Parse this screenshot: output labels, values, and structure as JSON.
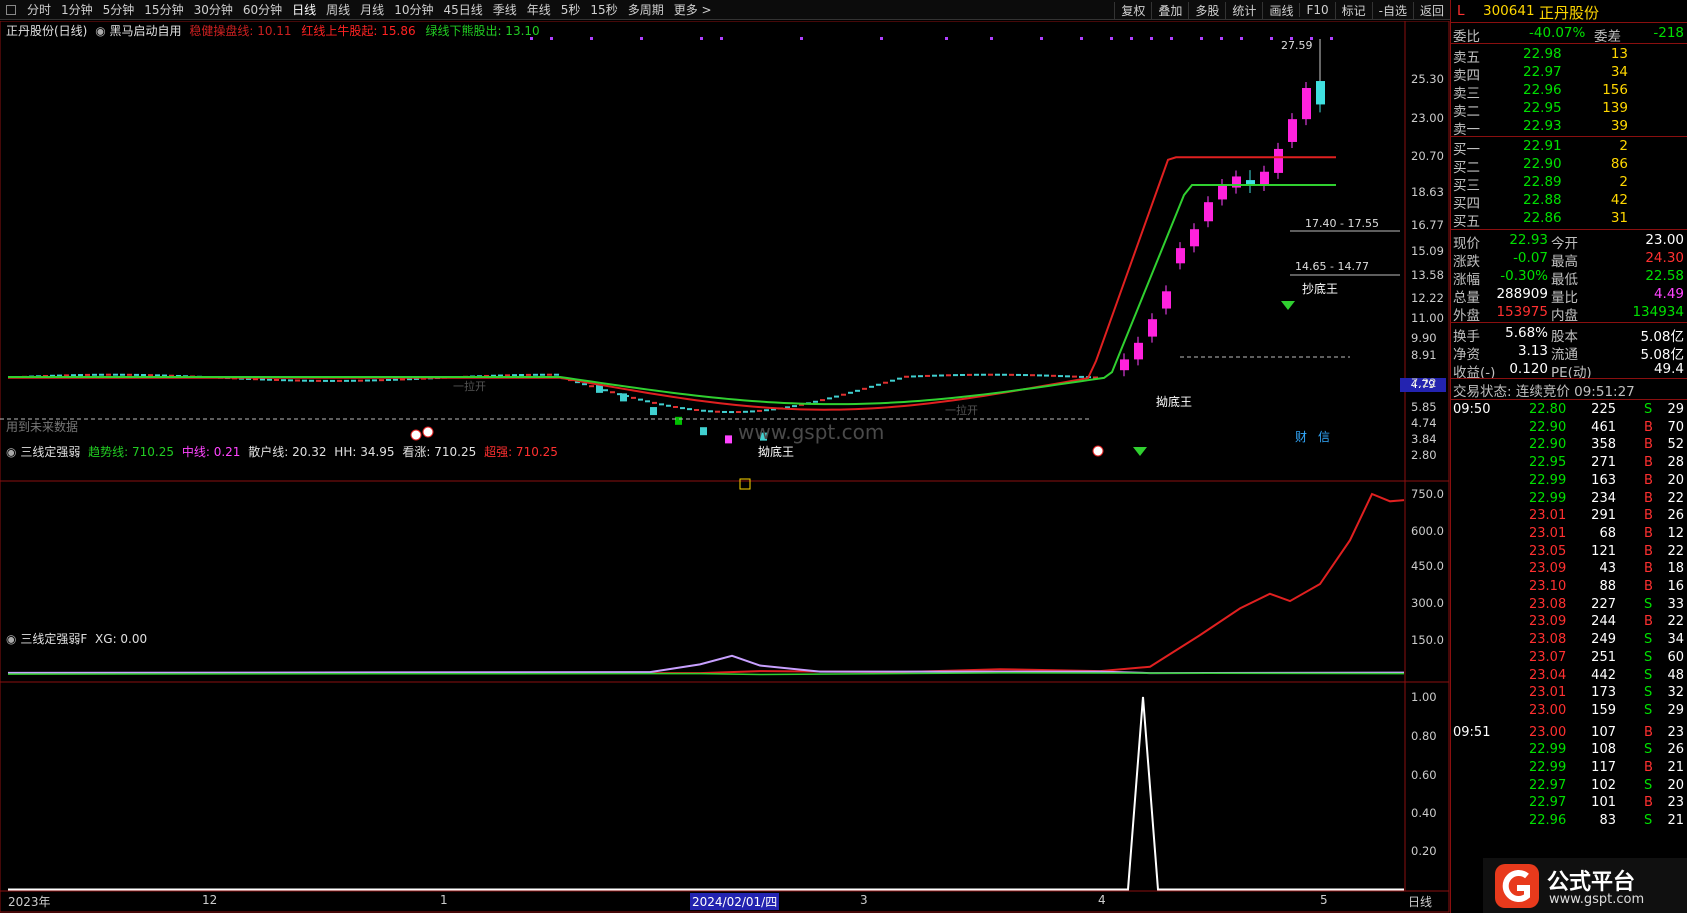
{
  "toolbar": {
    "left": [
      "分时",
      "1分钟",
      "5分钟",
      "15分钟",
      "30分钟",
      "60分钟",
      "日线",
      "周线",
      "月线",
      "10分钟",
      "45日线",
      "季线",
      "年线",
      "5秒",
      "15秒",
      "多周期",
      "更多 >"
    ],
    "selected": "日线",
    "right": [
      "复权",
      "叠加",
      "多股",
      "统计",
      "画线",
      "F10",
      "标记",
      "-自选",
      "返回"
    ]
  },
  "main_panel": {
    "stock_title": "正丹股份(日线)",
    "indicator": "黑马启动自用",
    "lbl1": "稳健操盘线: 10.11",
    "lbl2": "红线上牛股起: 15.86",
    "lbl3": "绿线下熊股出: 13.10",
    "future_note": "用到未来数据",
    "watermark": "www.gspt.com",
    "price_axis": [
      "25.30",
      "23.00",
      "20.70",
      "18.63",
      "16.77",
      "15.09",
      "13.58",
      "12.22",
      "11.00",
      "9.90",
      "8.91",
      "7.22",
      "5.85",
      "4.74",
      "3.84",
      "2.80"
    ],
    "current_price_tag": "4.79",
    "hi_label": "27.59",
    "band1": "17.40 - 17.55",
    "band2": "14.65 - 14.77",
    "ann": [
      "拗底王",
      "拗底王",
      "抄底王",
      "一拉开",
      "一拉开",
      "拗底王"
    ],
    "caibadge": "财",
    "xinbadge": "信"
  },
  "panel2": {
    "title": "三线定强弱",
    "trend": "趋势线: 710.25",
    "mid": "中线: 0.21",
    "retail": "散户线: 20.32",
    "hh": "HH: 34.95",
    "up": "看涨: 710.25",
    "sup": "超强: 710.25",
    "axis": [
      "750.0",
      "600.0",
      "450.0",
      "300.0",
      "150.0"
    ]
  },
  "panel3": {
    "title": "三线定强弱F",
    "xg": "XG: 0.00",
    "axis": [
      "1.00",
      "0.80",
      "0.60",
      "0.40",
      "0.20"
    ]
  },
  "time_axis": {
    "labels": [
      "2023年",
      "12",
      "1",
      "2024/02/01/四",
      "3",
      "4",
      "5"
    ],
    "period": "日线"
  },
  "quote": {
    "flag": "L",
    "code": "300641",
    "name": "正丹股份",
    "weibi": {
      "label": "委比",
      "value": "-40.07%",
      "label2": "委差",
      "value2": "-218"
    },
    "asks": [
      {
        "name": "卖五",
        "price": "22.98",
        "vol": "13"
      },
      {
        "name": "卖四",
        "price": "22.97",
        "vol": "34"
      },
      {
        "name": "卖三",
        "price": "22.96",
        "vol": "156"
      },
      {
        "name": "卖二",
        "price": "22.95",
        "vol": "139"
      },
      {
        "name": "卖一",
        "price": "22.93",
        "vol": "39"
      }
    ],
    "bids": [
      {
        "name": "买一",
        "price": "22.91",
        "vol": "2"
      },
      {
        "name": "买二",
        "price": "22.90",
        "vol": "86"
      },
      {
        "name": "买三",
        "price": "22.89",
        "vol": "2"
      },
      {
        "name": "买四",
        "price": "22.88",
        "vol": "42"
      },
      {
        "name": "买五",
        "price": "22.86",
        "vol": "31"
      }
    ],
    "stats": [
      {
        "l1": "现价",
        "v1": "22.93",
        "c1": "#00e000",
        "l2": "今开",
        "v2": "23.00",
        "c2": "#ffffff"
      },
      {
        "l1": "涨跌",
        "v1": "-0.07",
        "c1": "#00e000",
        "l2": "最高",
        "v2": "24.30",
        "c2": "#ff3030"
      },
      {
        "l1": "涨幅",
        "v1": "-0.30%",
        "c1": "#00e000",
        "l2": "最低",
        "v2": "22.58",
        "c2": "#00e000"
      },
      {
        "l1": "总量",
        "v1": "288909",
        "c1": "#ffffff",
        "l2": "量比",
        "v2": "4.49",
        "c2": "#ff44ff"
      },
      {
        "l1": "外盘",
        "v1": "153975",
        "c1": "#ff3030",
        "l2": "内盘",
        "v2": "134934",
        "c2": "#00e000"
      }
    ],
    "stats2": [
      {
        "l1": "换手",
        "v1": "5.68%",
        "l2": "股本",
        "v2": "5.08亿"
      },
      {
        "l1": "净资",
        "v1": "3.13",
        "l2": "流通",
        "v2": "5.08亿"
      },
      {
        "l1": "收益(-)",
        "v1": "0.120",
        "l2": "PE(动)",
        "v2": "49.4"
      }
    ],
    "trade_status": "交易状态: 连续竞价 09:51:27",
    "ticks": [
      {
        "t": "09:50",
        "p": "22.80",
        "v": "225",
        "bs": "S",
        "n": "29"
      },
      {
        "t": "",
        "p": "22.90",
        "v": "461",
        "bs": "B",
        "n": "70"
      },
      {
        "t": "",
        "p": "22.90",
        "v": "358",
        "bs": "B",
        "n": "52"
      },
      {
        "t": "",
        "p": "22.95",
        "v": "271",
        "bs": "B",
        "n": "28"
      },
      {
        "t": "",
        "p": "22.99",
        "v": "163",
        "bs": "B",
        "n": "20"
      },
      {
        "t": "",
        "p": "22.99",
        "v": "234",
        "bs": "B",
        "n": "22"
      },
      {
        "t": "",
        "p": "23.01",
        "v": "291",
        "bs": "B",
        "n": "26"
      },
      {
        "t": "",
        "p": "23.01",
        "v": "68",
        "bs": "B",
        "n": "12"
      },
      {
        "t": "",
        "p": "23.05",
        "v": "121",
        "bs": "B",
        "n": "22"
      },
      {
        "t": "",
        "p": "23.09",
        "v": "43",
        "bs": "B",
        "n": "18"
      },
      {
        "t": "",
        "p": "23.10",
        "v": "88",
        "bs": "B",
        "n": "16"
      },
      {
        "t": "",
        "p": "23.08",
        "v": "227",
        "bs": "S",
        "n": "33"
      },
      {
        "t": "",
        "p": "23.09",
        "v": "244",
        "bs": "B",
        "n": "22"
      },
      {
        "t": "",
        "p": "23.08",
        "v": "249",
        "bs": "S",
        "n": "34"
      },
      {
        "t": "",
        "p": "23.07",
        "v": "251",
        "bs": "S",
        "n": "60"
      },
      {
        "t": "",
        "p": "23.04",
        "v": "442",
        "bs": "S",
        "n": "48"
      },
      {
        "t": "",
        "p": "23.01",
        "v": "173",
        "bs": "S",
        "n": "32"
      },
      {
        "t": "",
        "p": "23.00",
        "v": "159",
        "bs": "S",
        "n": "29"
      },
      {
        "t": "09:51",
        "p": "23.00",
        "v": "107",
        "bs": "B",
        "n": "23"
      },
      {
        "t": "",
        "p": "22.99",
        "v": "108",
        "bs": "S",
        "n": "26"
      },
      {
        "t": "",
        "p": "22.99",
        "v": "117",
        "bs": "B",
        "n": "21"
      },
      {
        "t": "",
        "p": "22.97",
        "v": "102",
        "bs": "S",
        "n": "20"
      },
      {
        "t": "",
        "p": "22.97",
        "v": "101",
        "bs": "B",
        "n": "23"
      },
      {
        "t": "",
        "p": "22.96",
        "v": "83",
        "bs": "S",
        "n": "21"
      }
    ]
  },
  "logo": {
    "text": "公式平台",
    "url": "www.gspt.com"
  }
}
